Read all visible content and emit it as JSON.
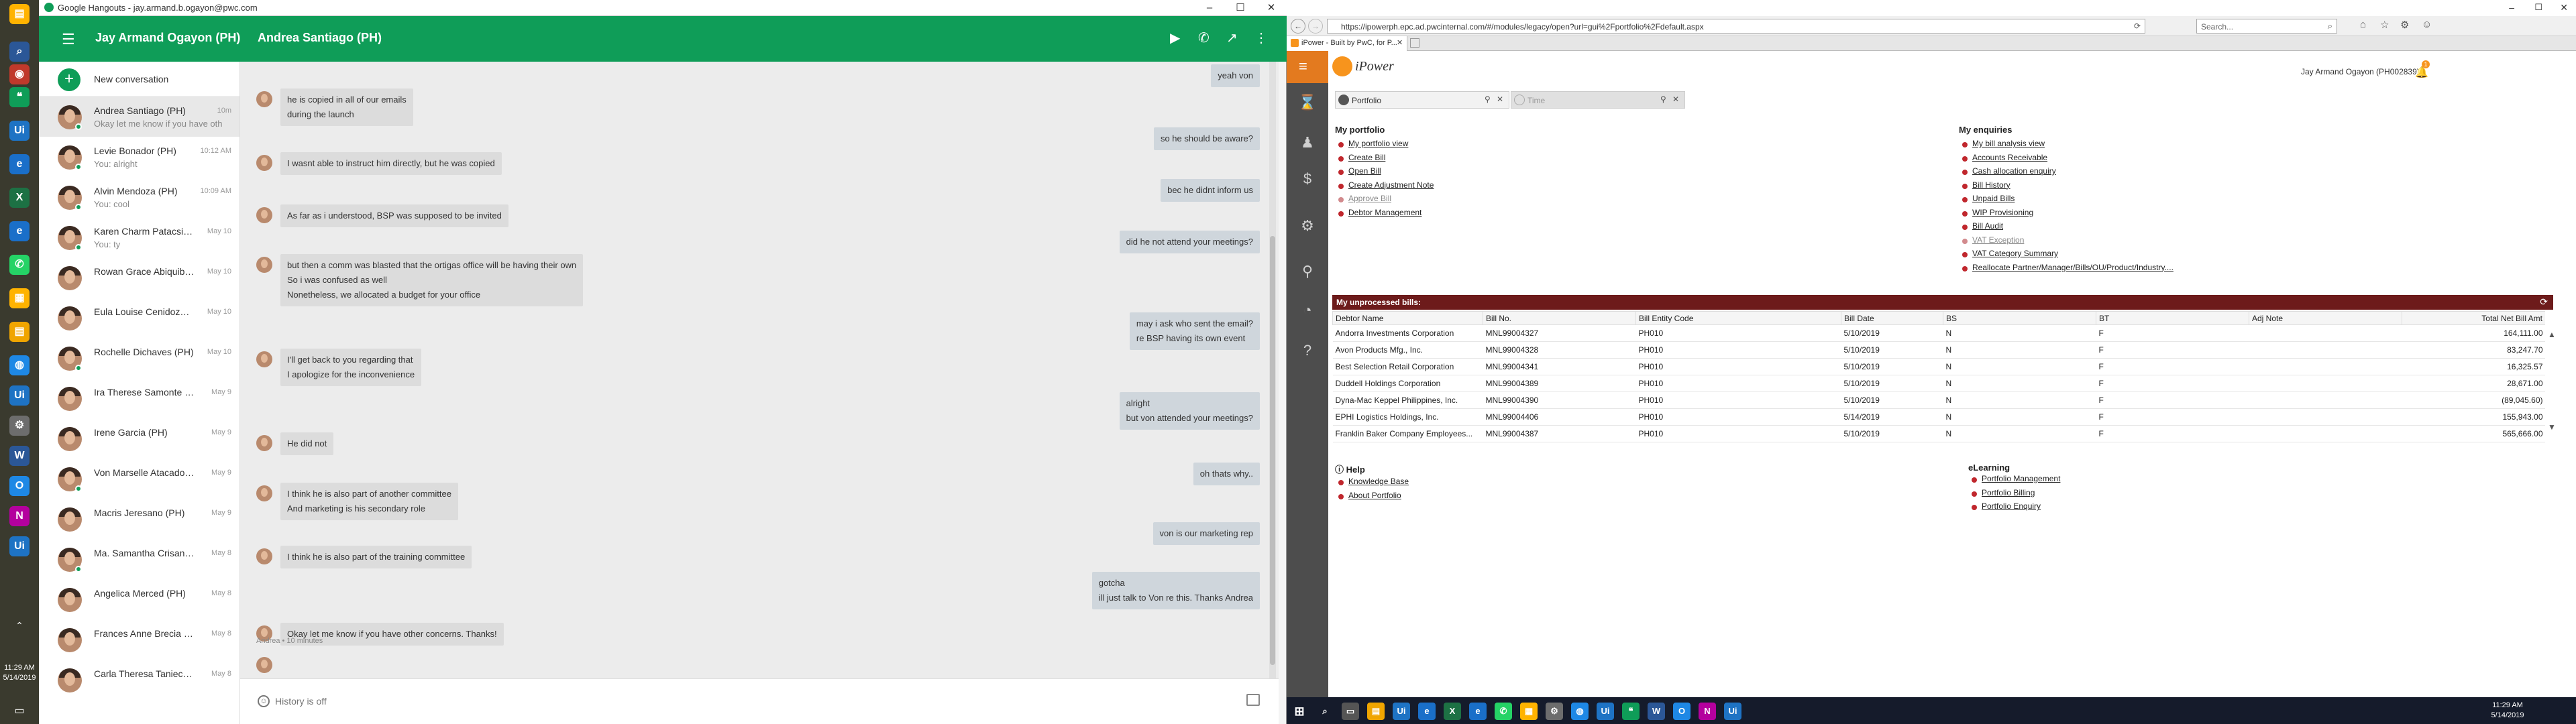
{
  "taskbar_left": {
    "time": "11:29 AM",
    "date": "5/14/2019"
  },
  "hangouts": {
    "window_title": "Google Hangouts - jay.armand.b.ogayon@pwc.com",
    "account_name": "Jay Armand Ogayon (PH)",
    "peer_name": "Andrea Santiago (PH)",
    "new_conversation": "New conversation",
    "compose_placeholder": "History is off",
    "contacts": [
      {
        "name": "Andrea Santiago (PH)",
        "preview": "Okay let me know if you have oth",
        "time": "10m"
      },
      {
        "name": "Levie Bonador (PH)",
        "preview": "You: alright",
        "time": "10:12 AM"
      },
      {
        "name": "Alvin Mendoza (PH)",
        "preview": "You: cool",
        "time": "10:09 AM"
      },
      {
        "name": "Karen Charm Patacsil ...",
        "preview": "You: ty",
        "time": "May 10"
      },
      {
        "name": "Rowan Grace Abiquibil ...",
        "preview": "",
        "time": "May 10"
      },
      {
        "name": "Eula Louise Cenidoza (...",
        "preview": "",
        "time": "May 10"
      },
      {
        "name": "Rochelle Dichaves (PH)",
        "preview": "",
        "time": "May 10"
      },
      {
        "name": "Ira Therese Samonte (PH)",
        "preview": "",
        "time": "May 9"
      },
      {
        "name": "Irene Garcia (PH)",
        "preview": "",
        "time": "May 9"
      },
      {
        "name": "Von Marselle Atacador (...",
        "preview": "",
        "time": "May 9"
      },
      {
        "name": "Macris Jeresano (PH)",
        "preview": "",
        "time": "May 9"
      },
      {
        "name": "Ma. Samantha Crisanta ...",
        "preview": "",
        "time": "May 8"
      },
      {
        "name": "Angelica Merced (PH)",
        "preview": "",
        "time": "May 8"
      },
      {
        "name": "Frances Anne Brecia (PH)",
        "preview": "",
        "time": "May 8"
      },
      {
        "name": "Carla Theresa Tanieca (...",
        "preview": "",
        "time": "May 8"
      }
    ],
    "messages": [
      {
        "dir": "out",
        "lines": [
          "yeah von"
        ]
      },
      {
        "dir": "in",
        "lines": [
          "he is copied in all of our emails",
          "during the launch"
        ]
      },
      {
        "dir": "out",
        "lines": [
          "so he should be aware?"
        ]
      },
      {
        "dir": "in",
        "lines": [
          "I wasnt able to instruct him directly, but he was copied"
        ]
      },
      {
        "dir": "out",
        "lines": [
          "bec he didnt inform us"
        ]
      },
      {
        "dir": "in",
        "lines": [
          "As far as i understood, BSP was supposed to be invited"
        ]
      },
      {
        "dir": "out",
        "lines": [
          "did he not attend your meetings?"
        ]
      },
      {
        "dir": "in",
        "lines": [
          "but then a comm was blasted that the ortigas office will be having their own",
          "So i was confused as well",
          "Nonetheless, we allocated a budget for your office"
        ]
      },
      {
        "dir": "out",
        "lines": [
          "may i ask who sent the email?",
          "re BSP having its own event"
        ]
      },
      {
        "dir": "in",
        "lines": [
          "I'll get back to you regarding that",
          "I apologize for the inconvenience"
        ]
      },
      {
        "dir": "out",
        "lines": [
          "alright",
          "but von attended your meetings?"
        ]
      },
      {
        "dir": "in",
        "lines": [
          "He did not"
        ]
      },
      {
        "dir": "out",
        "lines": [
          "oh thats why.."
        ]
      },
      {
        "dir": "in",
        "lines": [
          "I think he is also part of another committee",
          "And marketing is his secondary role"
        ]
      },
      {
        "dir": "out",
        "lines": [
          "von is our marketing rep"
        ]
      },
      {
        "dir": "in",
        "lines": [
          "I think he is also part of the training committee"
        ]
      },
      {
        "dir": "out",
        "lines": [
          "gotcha",
          "ill just talk to Von re this. Thanks Andrea"
        ]
      },
      {
        "dir": "in",
        "lines": [
          "Okay let me know if you have other concerns. Thanks!"
        ]
      }
    ],
    "last_meta": "Andrea • 10 minutes"
  },
  "ipower": {
    "url": "https://ipowerph.epc.ad.pwcinternal.com/#/modules/legacy/open?url=gui%2Fportfolio%2Fdefault.aspx",
    "search_placeholder": "Search...",
    "tab_title": "iPower - Built by PwC, for P...",
    "logo_text": "iPower",
    "user": "Jay Armand Ogayon (PH002839)",
    "notif_count": "1",
    "tab_portfolio": "Portfolio",
    "tab_time": "Time",
    "my_portfolio": {
      "title": "My portfolio",
      "links": [
        {
          "label": "My portfolio view",
          "enabled": true
        },
        {
          "label": "Create Bill",
          "enabled": true
        },
        {
          "label": "Open Bill",
          "enabled": true
        },
        {
          "label": "Create Adjustment Note",
          "enabled": true
        },
        {
          "label": "Approve Bill",
          "enabled": false
        },
        {
          "label": "Debtor Management",
          "enabled": true
        }
      ]
    },
    "my_enquiries": {
      "title": "My enquiries",
      "links": [
        {
          "label": "My bill analysis view",
          "enabled": true
        },
        {
          "label": "Accounts Receivable",
          "enabled": true
        },
        {
          "label": "Cash allocation enquiry",
          "enabled": true
        },
        {
          "label": "Bill History",
          "enabled": true
        },
        {
          "label": "Unpaid Bills",
          "enabled": true
        },
        {
          "label": "WIP Provisioning",
          "enabled": true
        },
        {
          "label": "Bill Audit",
          "enabled": true
        },
        {
          "label": "VAT Exception",
          "enabled": false
        },
        {
          "label": "VAT Category Summary",
          "enabled": true
        },
        {
          "label": "Reallocate Partner/Manager/Bills/OU/Product/Industry....",
          "enabled": true
        }
      ]
    },
    "bills": {
      "title": "My unprocessed bills:",
      "columns": [
        "Debtor Name",
        "Bill No.",
        "Bill Entity Code",
        "Bill Date",
        "BS",
        "BT",
        "Adj Note",
        "Total Net Bill Amt"
      ],
      "rows": [
        [
          "Andorra Investments Corporation",
          "MNL99004327",
          "PH010",
          "5/10/2019",
          "N",
          "F",
          "",
          "164,111.00"
        ],
        [
          "Avon Products Mfg., Inc.",
          "MNL99004328",
          "PH010",
          "5/10/2019",
          "N",
          "F",
          "",
          "83,247.70"
        ],
        [
          "Best Selection Retail Corporation",
          "MNL99004341",
          "PH010",
          "5/10/2019",
          "N",
          "F",
          "",
          "16,325.57"
        ],
        [
          "Duddell Holdings Corporation",
          "MNL99004389",
          "PH010",
          "5/10/2019",
          "N",
          "F",
          "",
          "28,671.00"
        ],
        [
          "Dyna-Mac Keppel Philippines, Inc.",
          "MNL99004390",
          "PH010",
          "5/10/2019",
          "N",
          "F",
          "",
          "(89,045.60)"
        ],
        [
          "EPHI Logistics Holdings, Inc.",
          "MNL99004406",
          "PH010",
          "5/14/2019",
          "N",
          "F",
          "",
          "155,943.00"
        ],
        [
          "Franklin Baker Company Employees...",
          "MNL99004387",
          "PH010",
          "5/10/2019",
          "N",
          "F",
          "",
          "565,666.00"
        ]
      ]
    },
    "help": {
      "title": "Help",
      "links": [
        "Knowledge Base",
        "About Portfolio"
      ]
    },
    "elearning": {
      "title": "eLearning",
      "links": [
        "Portfolio Management",
        "Portfolio Billing",
        "Portfolio Enquiry"
      ]
    }
  },
  "taskbar_bottom": {
    "time": "11:29 AM",
    "date": "5/14/2019"
  }
}
